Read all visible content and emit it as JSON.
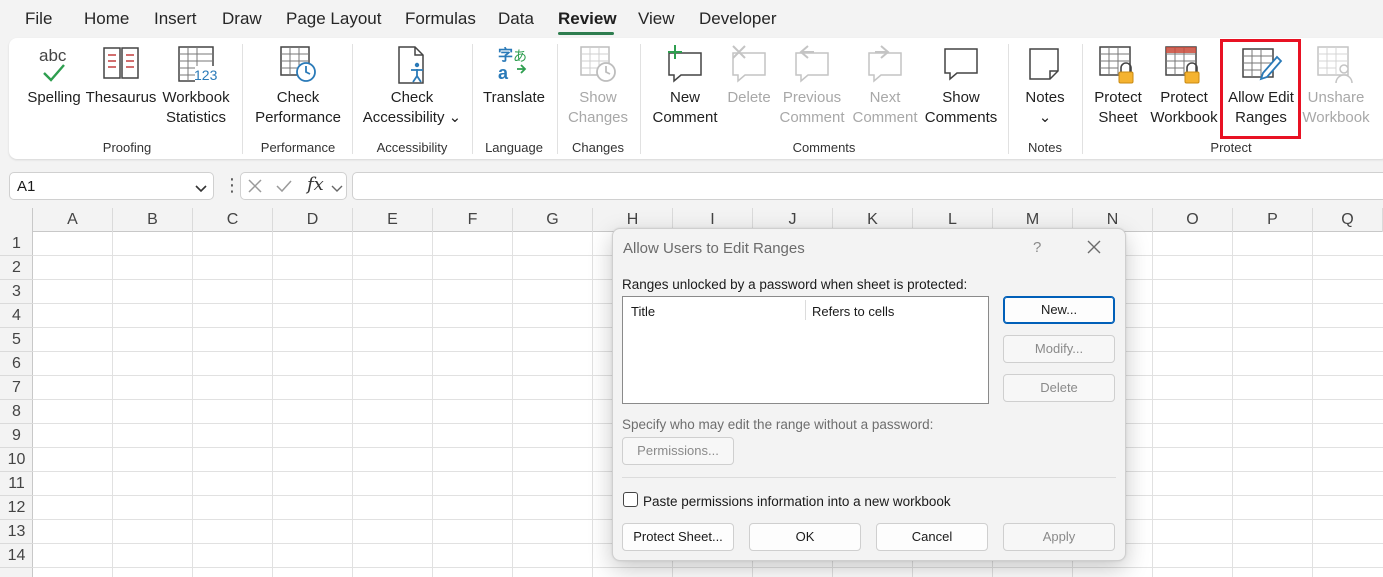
{
  "menu_tabs": [
    "File",
    "Home",
    "Insert",
    "Draw",
    "Page Layout",
    "Formulas",
    "Data",
    "Review",
    "View",
    "Developer"
  ],
  "active_tab": "Review",
  "ribbon": {
    "proofing": {
      "spelling": "Spelling",
      "thesaurus": "Thesaurus",
      "workbook_statistics": "Workbook\nStatistics",
      "group": "Proofing"
    },
    "performance": {
      "check_performance": "Check\nPerformance",
      "group": "Performance"
    },
    "accessibility": {
      "check_accessibility": "Check\nAccessibility ⌄",
      "group": "Accessibility"
    },
    "language": {
      "translate": "Translate",
      "group": "Language"
    },
    "changes": {
      "show_changes": "Show\nChanges",
      "group": "Changes"
    },
    "comments": {
      "new_comment": "New\nComment",
      "delete": "Delete",
      "previous_comment": "Previous\nComment",
      "next_comment": "Next\nComment",
      "show_comments": "Show\nComments",
      "group": "Comments"
    },
    "notes": {
      "notes": "Notes\n⌄",
      "group": "Notes"
    },
    "protect": {
      "protect_sheet": "Protect\nSheet",
      "protect_workbook": "Protect\nWorkbook",
      "allow_edit_ranges": "Allow Edit\nRanges",
      "unshare_workbook": "Unshare\nWorkbook",
      "group": "Protect"
    }
  },
  "formula_bar": {
    "name_box": "A1",
    "fx": "fx",
    "value": ""
  },
  "columns": [
    "A",
    "B",
    "C",
    "D",
    "E",
    "F",
    "G",
    "H",
    "I",
    "J",
    "K",
    "L",
    "M",
    "N",
    "O",
    "P",
    "Q"
  ],
  "rows": [
    "1",
    "2",
    "3",
    "4",
    "5",
    "6",
    "7",
    "8",
    "9",
    "10",
    "11",
    "12",
    "13",
    "14"
  ],
  "dialog": {
    "title": "Allow Users to Edit Ranges",
    "help": "?",
    "ranges_label": "Ranges unlocked by a password when sheet is protected:",
    "col_title": "Title",
    "col_refers": "Refers to cells",
    "new_button": "New...",
    "modify_button": "Modify...",
    "delete_button": "Delete",
    "specify_label": "Specify who may edit the range without a password:",
    "permissions_button": "Permissions...",
    "paste_label": "Paste permissions information into a new workbook",
    "paste_checked": false,
    "protect_sheet_button": "Protect Sheet...",
    "ok_button": "OK",
    "cancel_button": "Cancel",
    "apply_button": "Apply"
  },
  "colors": {
    "accent": "#2e7d4f",
    "highlight": "#e81123",
    "default_button": "#005fb8"
  }
}
